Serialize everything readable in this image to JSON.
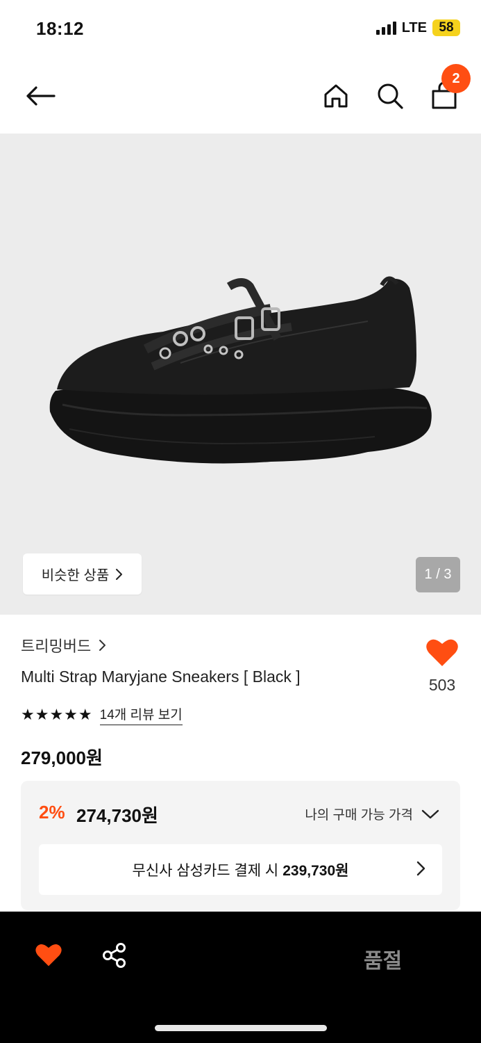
{
  "status_bar": {
    "time": "18:12",
    "network": "LTE",
    "battery": "58"
  },
  "nav": {
    "cart_count": "2"
  },
  "gallery": {
    "similar_label": "비슷한 상품",
    "page_indicator": "1 / 3"
  },
  "product": {
    "brand": "트리밍버드",
    "title": "Multi Strap Maryjane Sneakers [ Black ]",
    "likes": "503",
    "rating_stars": "★★★★★",
    "review_link": "14개 리뷰 보기",
    "price": "279,000원"
  },
  "price_box": {
    "discount_rate": "2%",
    "discount_price": "274,730원",
    "my_price_label": "나의 구매 가능 가격",
    "card_offer_label": "무신사 삼성카드 결제 시",
    "card_offer_price": "239,730원"
  },
  "bottom_bar": {
    "status_label": "품절"
  },
  "colors": {
    "accent": "#ff4e12",
    "background_image": "#ececec",
    "bottom_bar": "#000000"
  },
  "icons": [
    "back-arrow-icon",
    "home-icon",
    "search-icon",
    "shopping-bag-icon",
    "chevron-right-icon",
    "heart-icon",
    "chevron-down-icon",
    "share-icon"
  ]
}
